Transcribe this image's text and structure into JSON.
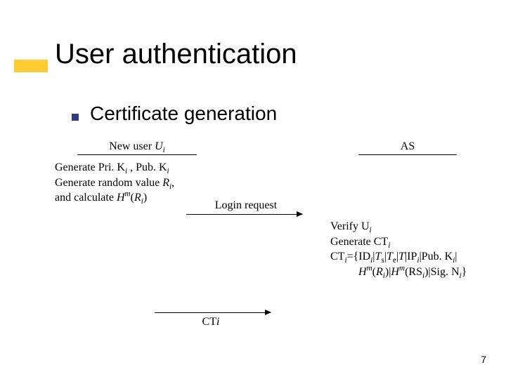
{
  "title": "User authentication",
  "subtitle": "Certificate generation",
  "left_header_prefix": "New user ",
  "left_header_var": "U",
  "right_header": "AS",
  "left_lines": {
    "l1_a": "Generate Pri. K",
    "l1_b": " , Pub. K",
    "l2_a": "Generate random value ",
    "l2_var": "R",
    "l2_b": ",",
    "l3_a": "and calculate ",
    "l3_H": "H",
    "l3_m": "m",
    "l3_open": "(",
    "l3_R": "R",
    "l3_close": ")"
  },
  "arrow1_label": "Login request",
  "arrow2_label_prefix": "CT",
  "right_lines": {
    "r1_a": "Verify U",
    "r2_a": "Generate CT",
    "r3_a": "CT",
    "r3_eq": "={ID",
    "r3_ts_pre": "|",
    "r3_T": "T",
    "r3_s": "s",
    "r3_te_pre": "|",
    "r3_e": "e",
    "r3_tip": "|",
    "r3_ip": "IP",
    "r3_pub": "|Pub. K",
    "r3_end": "|",
    "r4_H": "H",
    "r4_m": "m",
    "r4_R": "R",
    "r4_mid": ")|",
    "r4_RS": "RS",
    "r4_sig": ")|Sig. N",
    "r4_close": "}"
  },
  "sub_i": "i",
  "page_number": "7"
}
